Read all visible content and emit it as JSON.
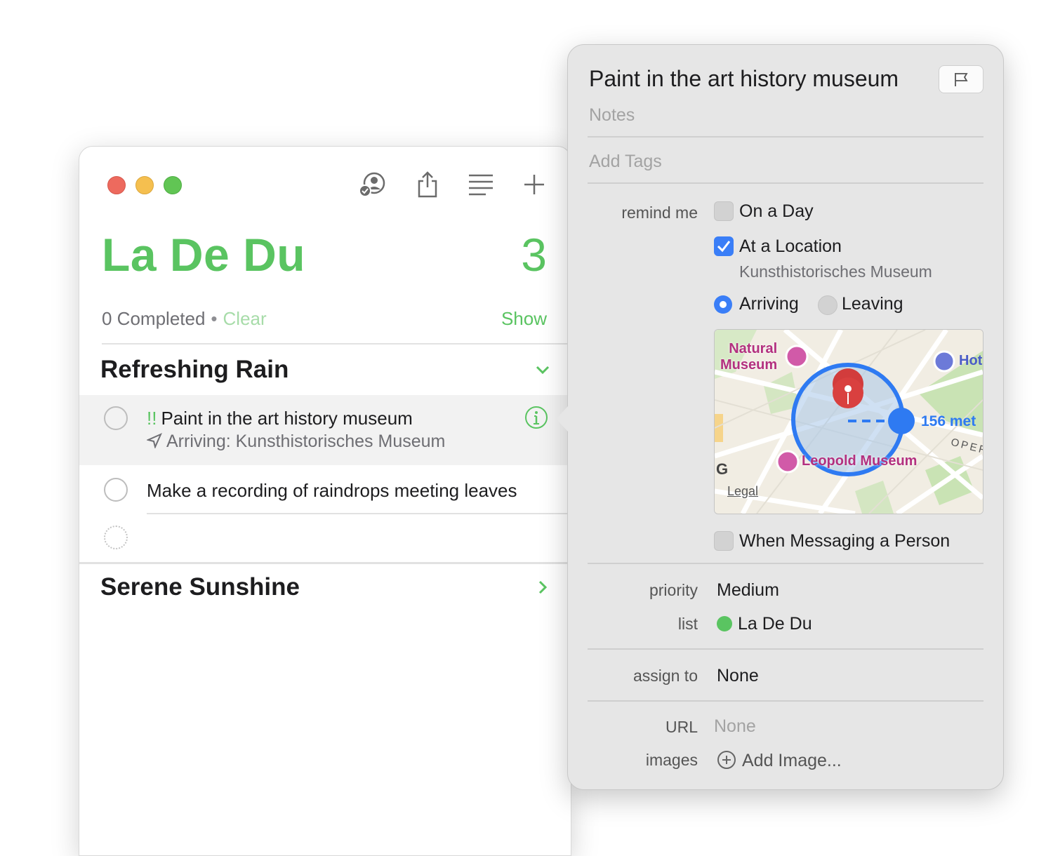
{
  "window": {
    "list_title": "La De Du",
    "count": "3",
    "completed_text": "0 Completed",
    "separator": "•",
    "clear_label": "Clear",
    "show_label": "Show",
    "accent_color": "#5ac461",
    "toolbar_icons": [
      "share-people-icon",
      "share-icon",
      "list-format-icon",
      "plus-icon"
    ]
  },
  "sections": [
    {
      "title": "Refreshing Rain",
      "expanded": true,
      "tasks": [
        {
          "priority_marks": "!!",
          "title": "Paint in the art history museum",
          "subtitle": "Arriving: Kunsthistorisches Museum",
          "selected": true
        },
        {
          "title": "Make a recording of raindrops meeting leaves",
          "selected": false
        }
      ]
    },
    {
      "title": "Serene Sunshine",
      "expanded": false
    }
  ],
  "inspector": {
    "title": "Paint in the art history museum",
    "notes_placeholder": "Notes",
    "tags_placeholder": "Add Tags",
    "remind_label": "remind me",
    "on_day_label": "On a Day",
    "on_day_checked": false,
    "location_label": "At a Location",
    "location_checked": true,
    "location_name": "Kunsthistorisches Museum",
    "arriving_label": "Arriving",
    "leaving_label": "Leaving",
    "arriving_selected": true,
    "map": {
      "natural_label_1": "Natural",
      "natural_label_2": "Museum",
      "hotel_label": "Hot",
      "distance_label": "156 met",
      "street_label": "OPER",
      "leopold_label": "Leopold Museum",
      "g_label": "G",
      "legal_label": "Legal"
    },
    "messaging_label": "When Messaging a Person",
    "messaging_checked": false,
    "priority_label": "priority",
    "priority_value": "Medium",
    "list_label": "list",
    "list_value": "La De Du",
    "assign_label": "assign to",
    "assign_value": "None",
    "url_label": "URL",
    "url_value": "None",
    "images_label": "images",
    "add_image_label": "Add Image..."
  }
}
